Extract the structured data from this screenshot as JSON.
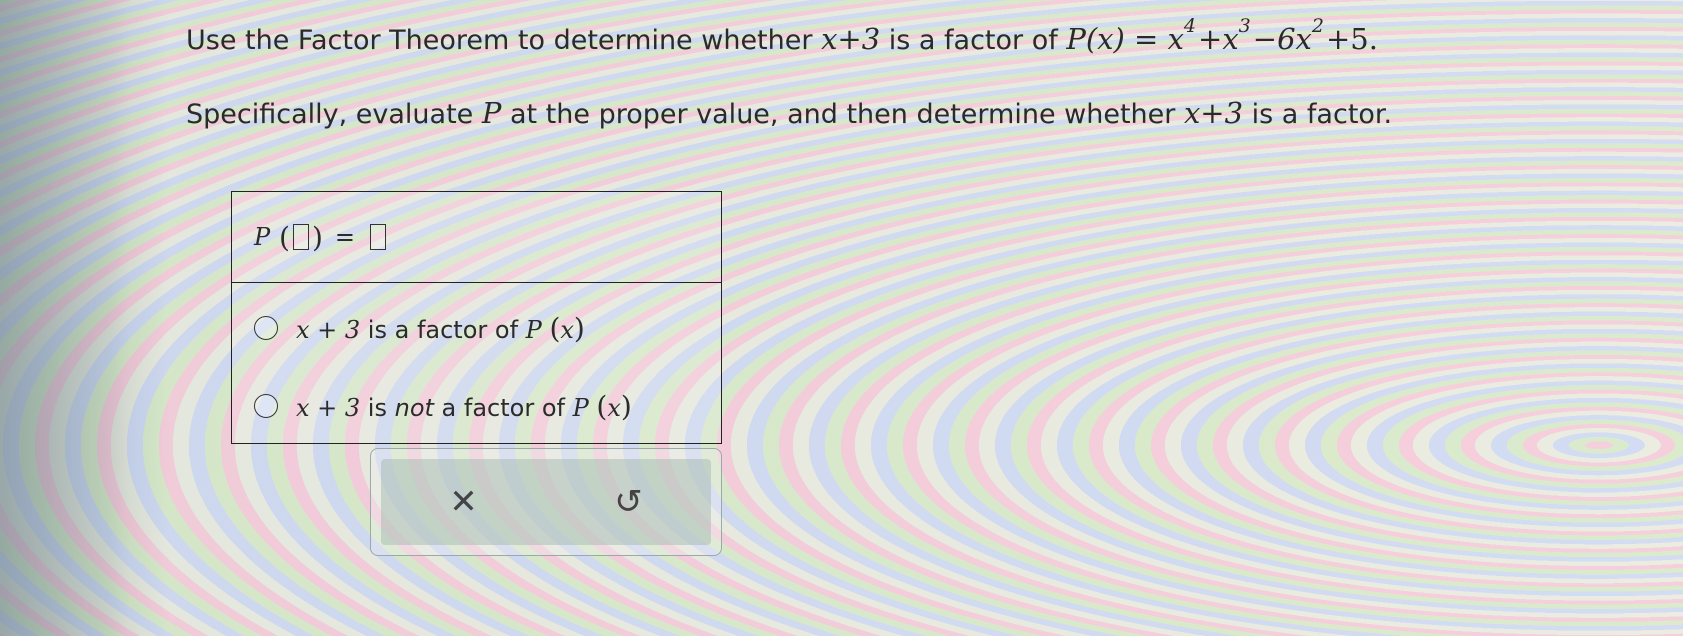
{
  "question": {
    "line1_intro": "Use the Factor Theorem to determine whether ",
    "divisor": "x+3",
    "line1_mid": " is a factor of ",
    "poly_lhs": "P(x) = ",
    "poly_t1": "x",
    "poly_e1": "4",
    "poly_t2": "+x",
    "poly_e2": "3",
    "poly_t3": "−6x",
    "poly_e3": "2",
    "poly_t4": "+5.",
    "line2_intro": "Specifically, evaluate ",
    "line2_var": "P",
    "line2_mid": " at the proper value, and then determine whether ",
    "line2_divisor": "x+3",
    "line2_end": " is a factor."
  },
  "answer": {
    "func_name": "P",
    "equals": "=",
    "input_value": "",
    "result_value": "",
    "options": [
      {
        "var": "x + 3",
        "pre": " is a ",
        "not": "",
        "post": "factor of ",
        "fn": "P",
        "arg": "x"
      },
      {
        "var": "x + 3",
        "pre": " is ",
        "not": "not",
        "post": " a factor of ",
        "fn": "P",
        "arg": "x"
      }
    ]
  },
  "buttons": {
    "clear_icon": "✕",
    "undo_icon": "↺"
  }
}
